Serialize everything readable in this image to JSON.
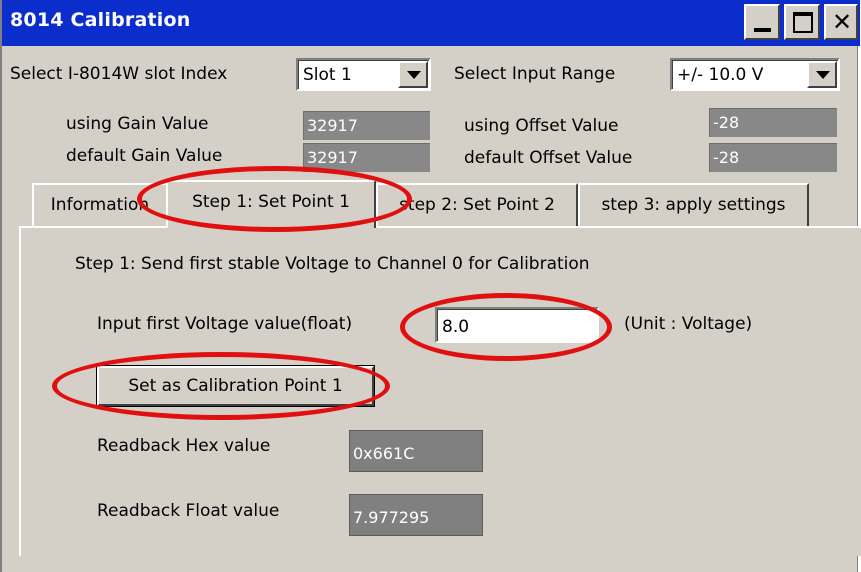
{
  "window": {
    "title": "8014 Calibration",
    "close_glyph": "✕"
  },
  "top": {
    "slot_label": "Select I-8014W slot Index",
    "slot_value": "Slot 1",
    "range_label": "Select Input Range",
    "range_value": "+/- 10.0 V",
    "using_gain_label": "using Gain Value",
    "using_gain_value": "32917",
    "default_gain_label": "default Gain Value",
    "default_gain_value": "32917",
    "using_offset_label": "using Offset Value",
    "using_offset_value": "-28",
    "default_offset_label": "default Offset Value",
    "default_offset_value": "-28"
  },
  "tabs": [
    {
      "label": "Information"
    },
    {
      "label": "Step 1: Set Point 1"
    },
    {
      "label": "step 2: Set Point 2"
    },
    {
      "label": "step 3: apply settings"
    }
  ],
  "step1": {
    "instruction": "Step 1: Send first stable Voltage to Channel 0 for Calibration",
    "input_label": "Input first Voltage value(float)",
    "input_value": "8.0",
    "unit_label": "(Unit : Voltage)",
    "set_button": "Set as Calibration Point 1",
    "readback_hex_label": "Readback Hex value",
    "readback_hex_value": "0x661C",
    "readback_float_label": "Readback Float value",
    "readback_float_value": "7.977295"
  },
  "annotations": {
    "color": "#e01010"
  }
}
